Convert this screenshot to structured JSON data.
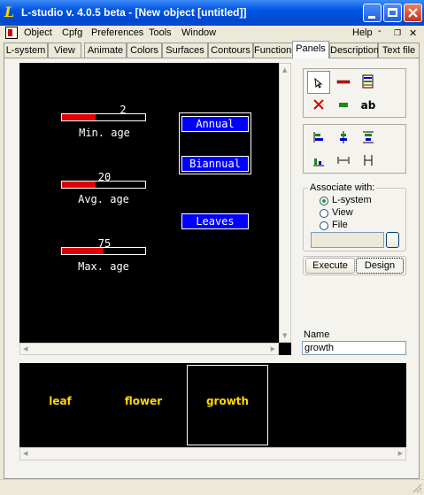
{
  "window": {
    "title": "L-studio v. 4.0.5 beta - [New object [untitled]]",
    "app_icon_letter": "L",
    "mdi_controls": [
      "_",
      "  ",
      "×"
    ]
  },
  "menu": {
    "items": [
      "Object",
      "Cpfg",
      "Preferences",
      "Tools",
      "Window"
    ],
    "help": "Help",
    "right_controls": [
      "-",
      "\u0000",
      "×"
    ]
  },
  "tabs": [
    "L-system",
    "View",
    "Animate",
    "Colors",
    "Surfaces",
    "Contours",
    "Functions",
    "Panels",
    "Description",
    "Text file"
  ],
  "active_tab": "Panels",
  "panel": {
    "sliders": [
      {
        "value": "2",
        "label": "Min. age",
        "fill": 0.4
      },
      {
        "value": "20",
        "label": "Avg. age",
        "fill": 0.4
      },
      {
        "value": "75",
        "label": "Max. age",
        "fill": 0.5
      }
    ],
    "group_buttons": [
      "Annual",
      "Biannual"
    ],
    "single_button": "Leaves"
  },
  "tools": {
    "top": [
      "↖",
      "▬",
      "☰",
      "✕",
      "▬",
      "ab"
    ],
    "align": [
      "▃",
      "‡",
      "⌷",
      "▄",
      "↤",
      "‖"
    ]
  },
  "associate": {
    "title": "Associate with:",
    "options": [
      "L-system",
      "View",
      "File"
    ],
    "selected": "L-system",
    "file_value": "",
    "browse": ""
  },
  "buttons": {
    "execute": "Execute",
    "design": "Design"
  },
  "name_field": {
    "label": "Name",
    "value": "growth"
  },
  "bottom_items": [
    "leaf",
    "flower",
    "growth"
  ],
  "colors": {
    "titlebar": "#0054e3",
    "canvas": "#000000",
    "accent_red": "#e00000",
    "button_blue": "#0000ff",
    "yellow_text": "#ffd800"
  }
}
